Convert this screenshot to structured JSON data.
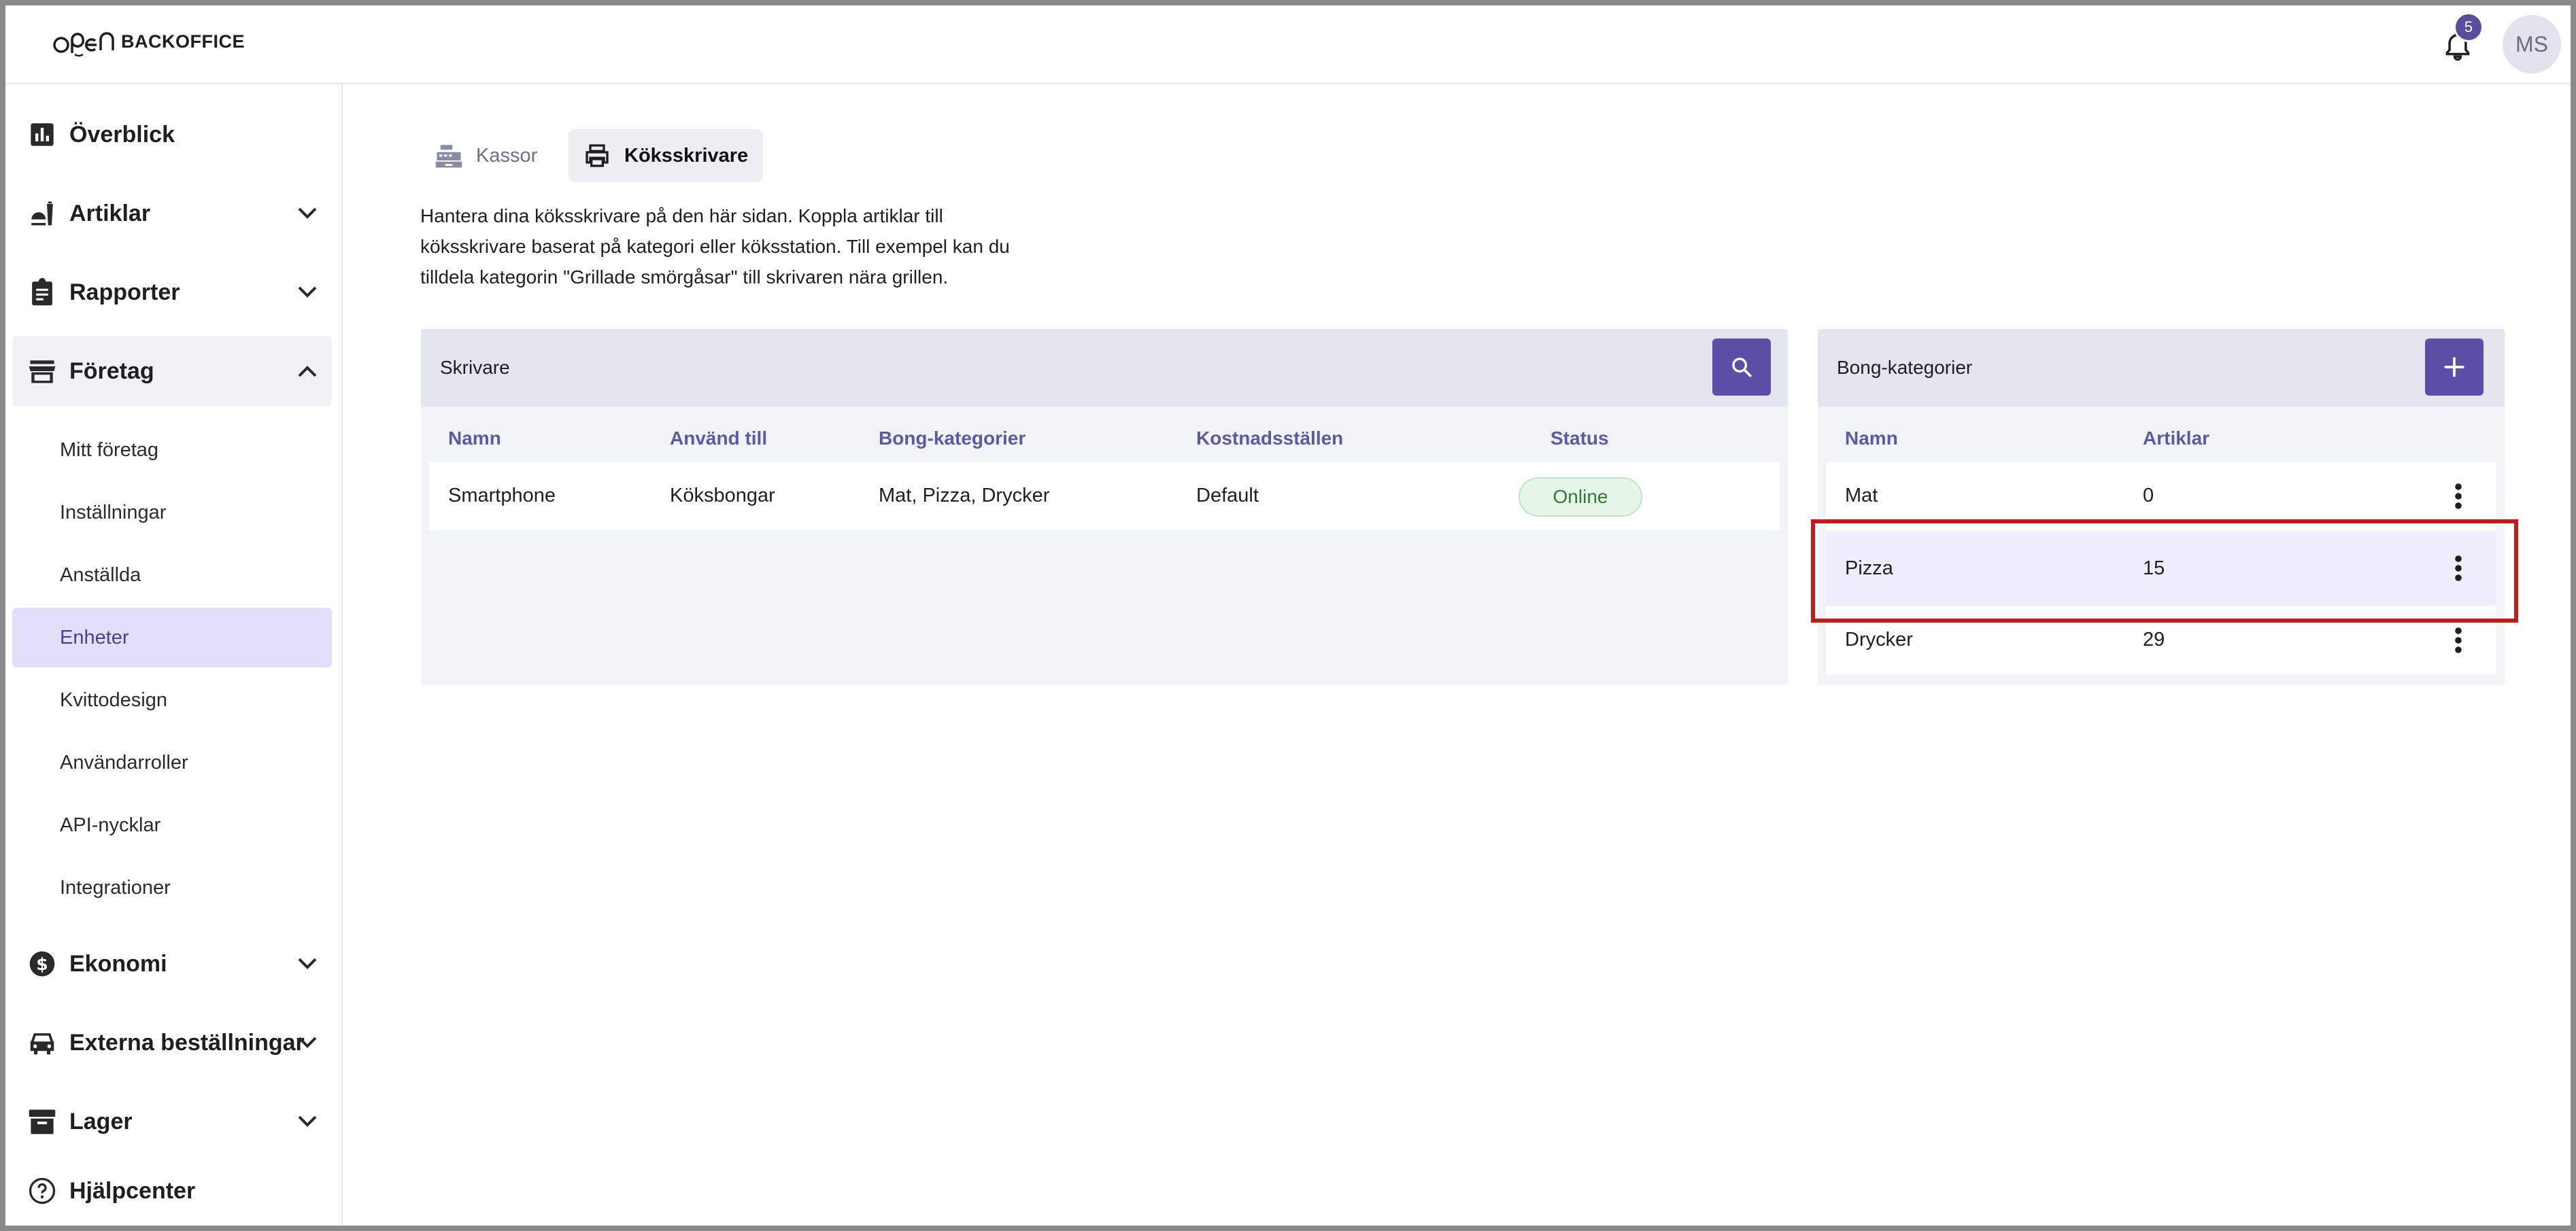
{
  "app": {
    "logo_text": "BACKOFFICE",
    "notification_count": "5",
    "user_initials": "MS"
  },
  "sidebar": {
    "items": [
      {
        "label": "Överblick",
        "icon": "bar-chart-icon"
      },
      {
        "label": "Artiklar",
        "icon": "food-icon"
      },
      {
        "label": "Rapporter",
        "icon": "clipboard-icon"
      },
      {
        "label": "Företag",
        "icon": "store-icon"
      },
      {
        "label": "Ekonomi",
        "icon": "dollar-icon"
      },
      {
        "label": "Externa beställningar",
        "icon": "car-icon"
      },
      {
        "label": "Lager",
        "icon": "archive-icon"
      },
      {
        "label": "Hjälpcenter",
        "icon": "help-icon"
      }
    ],
    "company_sub": [
      "Mitt företag",
      "Inställningar",
      "Anställda",
      "Enheter",
      "Kvittodesign",
      "Användarroller",
      "API-nycklar",
      "Integrationer"
    ],
    "active_sub": "Enheter"
  },
  "tabs": [
    {
      "label": "Kassor",
      "active": false
    },
    {
      "label": "Köksskrivare",
      "active": true
    }
  ],
  "description": "Hantera dina köksskrivare på den här sidan. Koppla artiklar till köksskrivare baserat på kategori eller köksstation. Till exempel kan du tilldela kategorin \"Grillade smörgåsar\" till skrivaren nära grillen.",
  "printers": {
    "title": "Skrivare",
    "columns": [
      "Namn",
      "Använd till",
      "Bong-kategorier",
      "Kostnadsställen",
      "Status"
    ],
    "rows": [
      {
        "name": "Smartphone",
        "use_for": "Köksbongar",
        "categories": "Mat, Pizza, Drycker",
        "cost_center": "Default",
        "status": "Online"
      }
    ]
  },
  "categories": {
    "title": "Bong-kategorier",
    "columns": [
      "Namn",
      "Artiklar"
    ],
    "rows": [
      {
        "name": "Mat",
        "count": "0"
      },
      {
        "name": "Pizza",
        "count": "15"
      },
      {
        "name": "Drycker",
        "count": "29"
      }
    ],
    "highlighted_row": "Pizza"
  },
  "colors": {
    "accent": "#5b4ea6",
    "active_nav_bg": "#e3defa",
    "highlight": "#c01c1c",
    "online": "#2f7a36"
  }
}
